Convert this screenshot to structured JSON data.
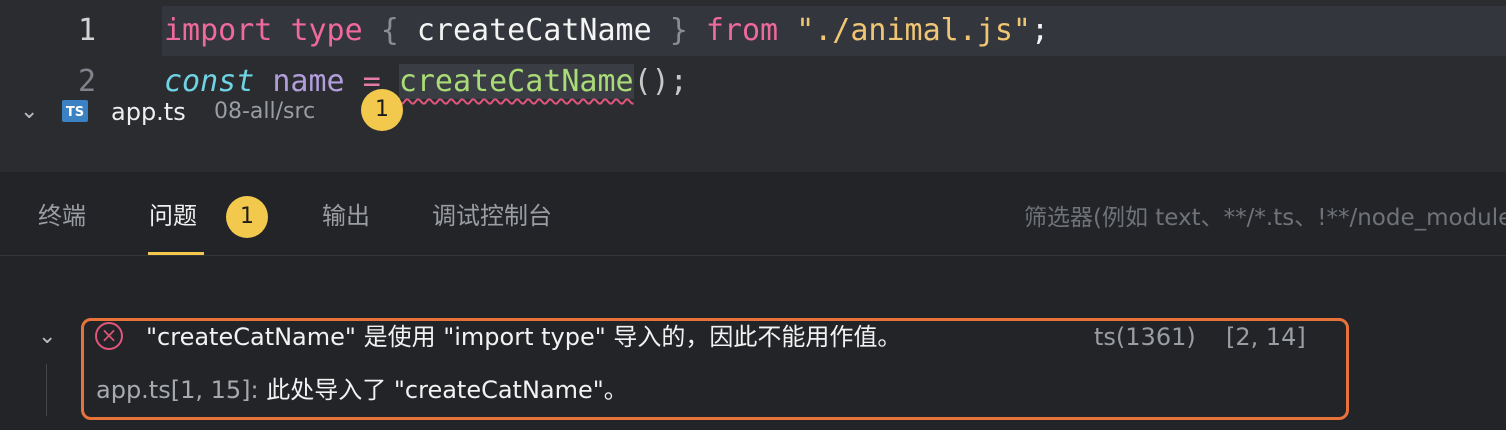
{
  "editor": {
    "lines": [
      {
        "number": "1",
        "tokens": {
          "import": "import",
          "type": "type",
          "lbrace": "{",
          "name": "createCatName",
          "rbrace": "}",
          "from": "from",
          "module": "\"./animal.js\"",
          "semi": ";"
        }
      },
      {
        "number": "2",
        "tokens": {
          "const": "const",
          "var": "name",
          "eq": "=",
          "call": "createCatName",
          "parens": "()",
          "semi": ";"
        }
      }
    ]
  },
  "panel": {
    "tabs": [
      {
        "label": "终端",
        "active": false
      },
      {
        "label": "问题",
        "active": true,
        "badge": "1"
      },
      {
        "label": "输出",
        "active": false
      },
      {
        "label": "调试控制台",
        "active": false
      }
    ],
    "filter_placeholder": "筛选器(例如 text、**/*.ts、!**/node_modules/**)"
  },
  "problems": {
    "file": {
      "icon": "TS",
      "name": "app.ts",
      "path": "08-all/src",
      "count": "1"
    },
    "error": {
      "icon": "error-circle-icon",
      "message": "\"createCatName\" 是使用 \"import type\" 导入的，因此不能用作值。",
      "code": "ts(1361)",
      "position": "[2, 14]",
      "related_location": "app.ts[1, 15]:",
      "related_message": " 此处导入了 \"createCatName\"。"
    }
  },
  "colors": {
    "accent": "#f2c94c",
    "error": "#e0557a",
    "highlight_border": "#e8733a"
  }
}
